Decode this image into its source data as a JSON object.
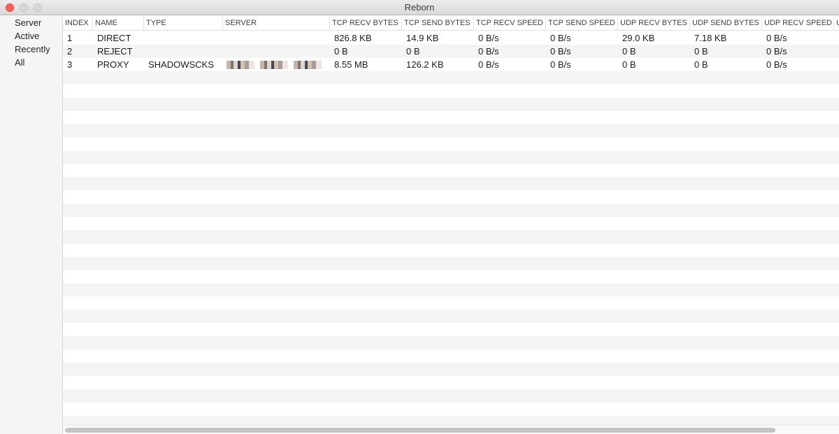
{
  "window": {
    "title": "Reborn"
  },
  "sidebar": {
    "items": [
      {
        "label": "Server",
        "selected": true
      },
      {
        "label": "Active",
        "selected": false
      },
      {
        "label": "Recently",
        "selected": false
      },
      {
        "label": "All",
        "selected": false
      }
    ]
  },
  "table": {
    "columns": [
      "INDEX",
      "NAME",
      "TYPE",
      "SERVER",
      "TCP RECV BYTES",
      "TCP SEND BYTES",
      "TCP RECV SPEED",
      "TCP SEND SPEED",
      "UDP RECV BYTES",
      "UDP SEND BYTES",
      "UDP RECV SPEED",
      "U"
    ],
    "rows": [
      {
        "index": "1",
        "name": "DIRECT",
        "type": "",
        "server_blurred": false,
        "tcp_recv_bytes": "826.8 KB",
        "tcp_send_bytes": "14.9 KB",
        "tcp_recv_speed": "0 B/s",
        "tcp_send_speed": "0 B/s",
        "udp_recv_bytes": "29.0 KB",
        "udp_send_bytes": "7.18 KB",
        "udp_recv_speed": "0 B/s"
      },
      {
        "index": "2",
        "name": "REJECT",
        "type": "",
        "server_blurred": false,
        "tcp_recv_bytes": "0 B",
        "tcp_send_bytes": "0 B",
        "tcp_recv_speed": "0 B/s",
        "tcp_send_speed": "0 B/s",
        "udp_recv_bytes": "0 B",
        "udp_send_bytes": "0 B",
        "udp_recv_speed": "0 B/s"
      },
      {
        "index": "3",
        "name": "PROXY",
        "type": "SHADOWSCKS",
        "server_blurred": true,
        "tcp_recv_bytes": "8.55 MB",
        "tcp_send_bytes": "126.2 KB",
        "tcp_recv_speed": "0 B/s",
        "tcp_send_speed": "0 B/s",
        "udp_recv_bytes": "0 B",
        "udp_send_bytes": "0 B",
        "udp_recv_speed": "0 B/s"
      }
    ]
  },
  "colors": {
    "close_button": "#fc5f57",
    "row_stripe": "#f4f4f4",
    "sidebar_bg": "#f5f5f5"
  },
  "icons": {
    "close": "close-button-icon",
    "minimize": "minimize-button-icon",
    "zoom": "zoom-button-icon"
  }
}
